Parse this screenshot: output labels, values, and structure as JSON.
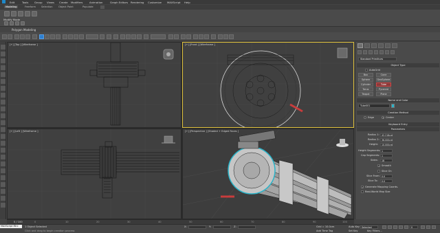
{
  "menu": [
    "Edit",
    "Tools",
    "Group",
    "Views",
    "Create",
    "Modifiers",
    "Animation",
    "Graph Editors",
    "Rendering",
    "Customize",
    "MAXScript",
    "Help"
  ],
  "ribbon_tabs": [
    "Modeling",
    "Freeform",
    "Selection",
    "Object Paint",
    "Populate"
  ],
  "ribbon_panel_label": "Modify Mode",
  "polygon_modeling_label": "Polygon Modeling",
  "viewport_labels": {
    "top": "[+] [Top ] [Wireframe ]",
    "front": "[+] [Front ] [Wireframe ]",
    "left": "[+] [Left ] [Wireframe ]",
    "persp": "[+] [Perspective ] [Shaded + Edged Faces ]"
  },
  "command_panel": {
    "category_dropdown": "Standard Primitives",
    "object_type_header": "Object Type",
    "autogrid_label": "AutoGrid",
    "object_buttons": [
      "Box",
      "Cone",
      "Sphere",
      "GeoSphere",
      "Cylinder",
      "Tube",
      "Torus",
      "Pyramid",
      "Teapot",
      "Plane"
    ],
    "name_color_header": "Name and Color",
    "name_value": "Tube001",
    "creation_method_header": "Creation Method",
    "creation_options": [
      "Edge",
      "Center"
    ],
    "keyboard_entry_header": "Keyboard Entry",
    "parameters_header": "Parameters",
    "params": [
      {
        "label": "Radius 1:",
        "value": "42.218cm"
      },
      {
        "label": "Radius 2:",
        "value": "36.000cm"
      },
      {
        "label": "Height:",
        "value": "10.000cm"
      },
      {
        "label": "Height Segments:",
        "value": "1"
      },
      {
        "label": "Cap Segments:",
        "value": "1"
      },
      {
        "label": "Sides:",
        "value": "18"
      }
    ],
    "smooth_label": "Smooth",
    "slice_on_label": "Slice On",
    "slice_from_label": "Slice From:",
    "slice_from_value": "0.0",
    "slice_to_label": "Slice To:",
    "slice_to_value": "0.0",
    "gen_mapping_label": "Generate Mapping Coords.",
    "real_world_label": "Real-World Map Size"
  },
  "timebar": {
    "frame_label": "0 / 100",
    "ticks": [
      "0",
      "10",
      "20",
      "30",
      "40",
      "50",
      "60",
      "70",
      "80",
      "90",
      "100"
    ]
  },
  "status": {
    "listener": "MAXScript Mini",
    "selected_text": "1 Object Selected",
    "prompt_text": "Click and drag to begin creation process",
    "x_label": "X:",
    "y_label": "Y:",
    "z_label": "Z:",
    "grid_text": "Grid = 10.0cm",
    "autokey_label": "Auto Key",
    "autokey_value": "Selected",
    "setkey_label": "Set Key",
    "keyfilters_label": "Key Filters...",
    "add_time_tag": "Add Time Tag",
    "frame_value": "0"
  },
  "colors": {
    "accent_red": "#c83c3c",
    "name_swatch": "#2ab3c8",
    "selection_yellow": "#e0c23c"
  }
}
